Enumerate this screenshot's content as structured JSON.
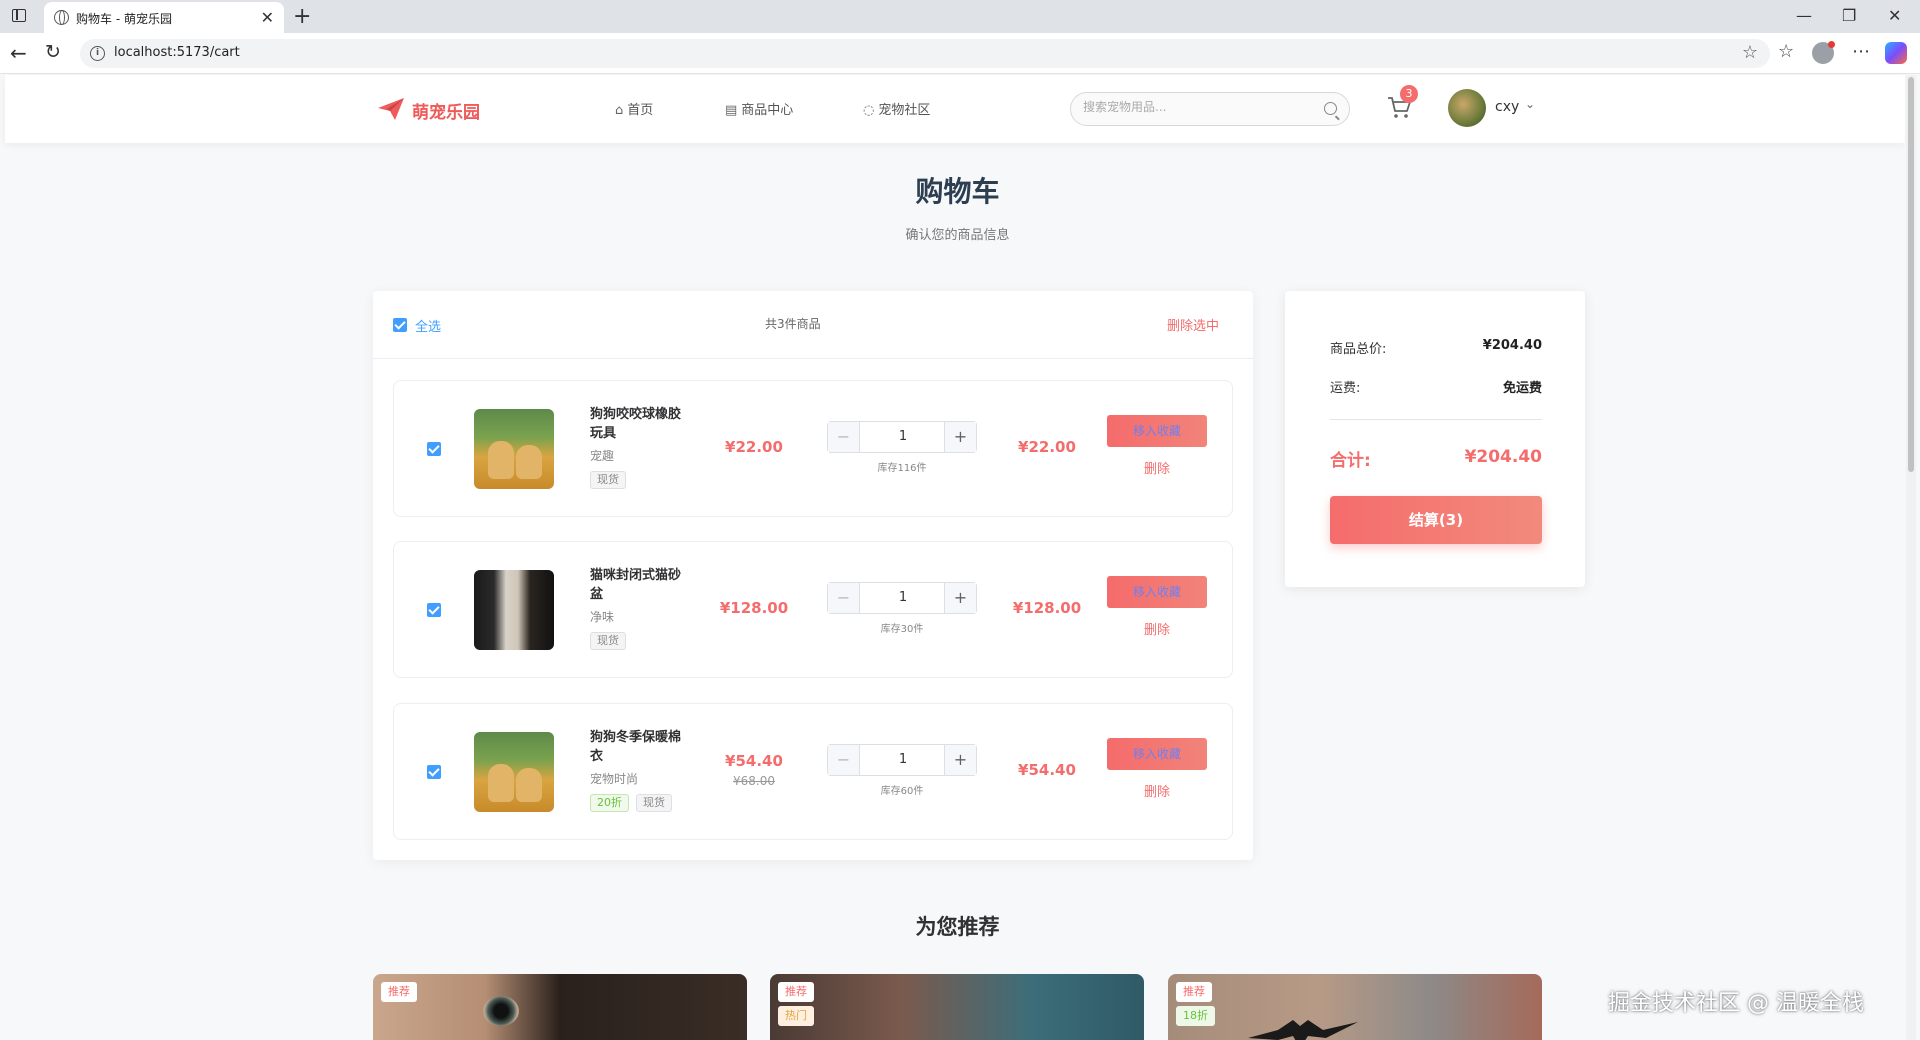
{
  "browser": {
    "tab_title": "购物车 - 萌宠乐园",
    "url": "localhost:5173/cart"
  },
  "header": {
    "logo": "萌宠乐园",
    "nav": [
      {
        "label": "首页",
        "icon": "home-icon"
      },
      {
        "label": "商品中心",
        "icon": "shop-icon"
      },
      {
        "label": "宠物社区",
        "icon": "chat-icon"
      }
    ],
    "search_placeholder": "搜索宠物用品...",
    "cart_count": "3",
    "username": "cxy"
  },
  "page": {
    "title": "购物车",
    "subtitle": "确认您的商品信息"
  },
  "cart": {
    "select_all": "全选",
    "count_text": "共3件商品",
    "delete_selected": "删除选中",
    "items": [
      {
        "name": "狗狗咬咬球橡胶玩具",
        "brand": "宠趣",
        "tags": [
          "现货"
        ],
        "price": "¥22.00",
        "orig_price": "",
        "qty": "1",
        "stock": "库存116件",
        "subtotal": "¥22.00",
        "fav_label": "移入收藏",
        "delete_label": "删除"
      },
      {
        "name": "猫咪封闭式猫砂盆",
        "brand": "净味",
        "tags": [
          "现货"
        ],
        "price": "¥128.00",
        "orig_price": "",
        "qty": "1",
        "stock": "库存30件",
        "subtotal": "¥128.00",
        "fav_label": "移入收藏",
        "delete_label": "删除"
      },
      {
        "name": "狗狗冬季保暖棉衣",
        "brand": "宠物时尚",
        "tags": [
          "20折",
          "现货"
        ],
        "price": "¥54.40",
        "orig_price": "¥68.00",
        "qty": "1",
        "stock": "库存60件",
        "subtotal": "¥54.40",
        "fav_label": "移入收藏",
        "delete_label": "删除"
      }
    ]
  },
  "summary": {
    "goods_total_label": "商品总价:",
    "goods_total": "¥204.40",
    "shipping_label": "运费:",
    "shipping": "免运费",
    "total_label": "合计:",
    "total": "¥204.40",
    "checkout": "结算(3)"
  },
  "recommend": {
    "title": "为您推荐",
    "cards": [
      {
        "badges": [
          "推荐"
        ]
      },
      {
        "badges": [
          "推荐",
          "热门"
        ]
      },
      {
        "badges": [
          "推荐",
          "18折"
        ]
      }
    ]
  },
  "watermark": "掘金技术社区 @ 温暖全栈"
}
